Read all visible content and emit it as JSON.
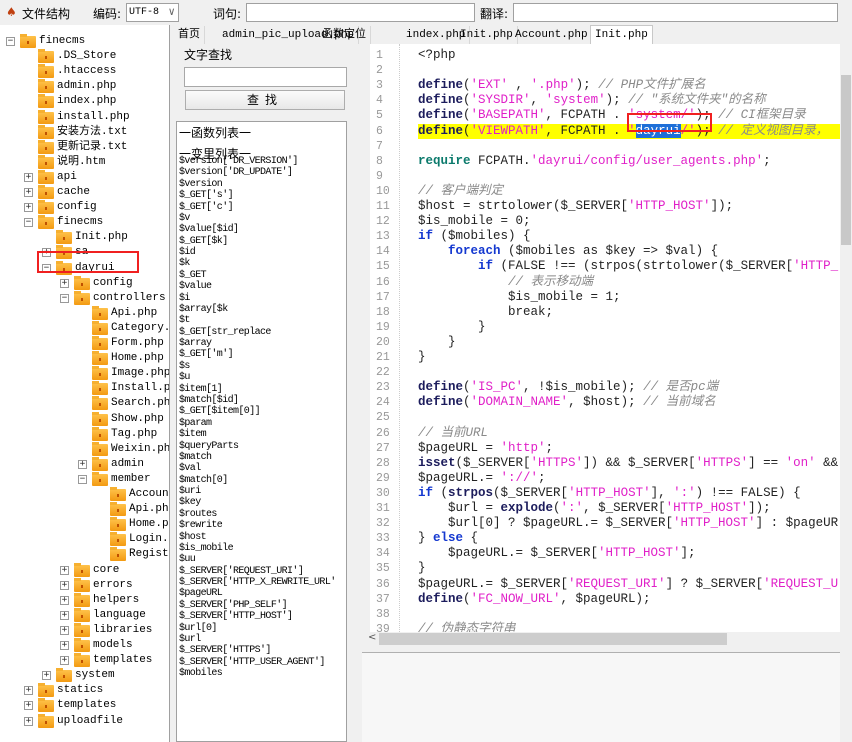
{
  "toolbar": {
    "file_structure_label": "文件结构",
    "encoding_label": "编码:",
    "encoding_value": "UTF-8",
    "query_label": "词句:",
    "query_value": "",
    "translate_label": "翻译:",
    "translate_value": ""
  },
  "tree": [
    {
      "name": "finecms",
      "level": 0,
      "toggle": "-"
    },
    {
      "name": ".DS_Store",
      "level": 1,
      "toggle": ""
    },
    {
      "name": ".htaccess",
      "level": 1,
      "toggle": ""
    },
    {
      "name": "admin.php",
      "level": 1,
      "toggle": ""
    },
    {
      "name": "index.php",
      "level": 1,
      "toggle": ""
    },
    {
      "name": "install.php",
      "level": 1,
      "toggle": ""
    },
    {
      "name": "安装方法.txt",
      "level": 1,
      "toggle": ""
    },
    {
      "name": "更新记录.txt",
      "level": 1,
      "toggle": ""
    },
    {
      "name": "说明.htm",
      "level": 1,
      "toggle": ""
    },
    {
      "name": "api",
      "level": 1,
      "toggle": "+"
    },
    {
      "name": "cache",
      "level": 1,
      "toggle": "+"
    },
    {
      "name": "config",
      "level": 1,
      "toggle": "+"
    },
    {
      "name": "finecms",
      "level": 1,
      "toggle": "-"
    },
    {
      "name": "Init.php",
      "level": 2,
      "toggle": ""
    },
    {
      "name": "sa",
      "level": 2,
      "toggle": "+"
    },
    {
      "name": "dayrui",
      "level": 2,
      "toggle": "-"
    },
    {
      "name": "config",
      "level": 3,
      "toggle": "+"
    },
    {
      "name": "controllers",
      "level": 3,
      "toggle": "-"
    },
    {
      "name": "Api.php",
      "level": 4,
      "toggle": ""
    },
    {
      "name": "Category.p",
      "level": 4,
      "toggle": ""
    },
    {
      "name": "Form.php",
      "level": 4,
      "toggle": ""
    },
    {
      "name": "Home.php",
      "level": 4,
      "toggle": ""
    },
    {
      "name": "Image.php",
      "level": 4,
      "toggle": ""
    },
    {
      "name": "Install.ph",
      "level": 4,
      "toggle": ""
    },
    {
      "name": "Search.php",
      "level": 4,
      "toggle": ""
    },
    {
      "name": "Show.php",
      "level": 4,
      "toggle": ""
    },
    {
      "name": "Tag.php",
      "level": 4,
      "toggle": ""
    },
    {
      "name": "Weixin.php",
      "level": 4,
      "toggle": ""
    },
    {
      "name": "admin",
      "level": 4,
      "toggle": "+"
    },
    {
      "name": "member",
      "level": 4,
      "toggle": "-"
    },
    {
      "name": "Account",
      "level": 5,
      "toggle": ""
    },
    {
      "name": "Api.php",
      "level": 5,
      "toggle": ""
    },
    {
      "name": "Home.pl",
      "level": 5,
      "toggle": ""
    },
    {
      "name": "Login.p",
      "level": 5,
      "toggle": ""
    },
    {
      "name": "Regist",
      "level": 5,
      "toggle": ""
    },
    {
      "name": "core",
      "level": 3,
      "toggle": "+"
    },
    {
      "name": "errors",
      "level": 3,
      "toggle": "+"
    },
    {
      "name": "helpers",
      "level": 3,
      "toggle": "+"
    },
    {
      "name": "language",
      "level": 3,
      "toggle": "+"
    },
    {
      "name": "libraries",
      "level": 3,
      "toggle": "+"
    },
    {
      "name": "models",
      "level": 3,
      "toggle": "+"
    },
    {
      "name": "templates",
      "level": 3,
      "toggle": "+"
    },
    {
      "name": "system",
      "level": 2,
      "toggle": "+"
    },
    {
      "name": "statics",
      "level": 1,
      "toggle": "+"
    },
    {
      "name": "templates",
      "level": 1,
      "toggle": "+"
    },
    {
      "name": "uploadfile",
      "level": 1,
      "toggle": "+"
    }
  ],
  "tree_highlighted": "dayrui",
  "tabs": [
    {
      "label": "首页",
      "active": false
    },
    {
      "label": "admin_pic_upload.php",
      "active": false
    },
    {
      "label": "函数定位",
      "active": false
    },
    {
      "label": "index.php",
      "active": false
    },
    {
      "label": "Init.php",
      "active": false
    },
    {
      "label": "Account.php",
      "active": false
    },
    {
      "label": "Init.php",
      "active": true
    }
  ],
  "search": {
    "group_label": "文字查找",
    "input_value": "",
    "button_label": "查找"
  },
  "func_list": {
    "functions_header": "一函数列表一",
    "variables_header": "一变里列表一",
    "variables": [
      "$version['DR_VERSION']",
      "$version['DR_UPDATE']",
      "$version",
      "$_GET['s']",
      "$_GET['c']",
      "$v",
      "$value[$id]",
      "$_GET[$k]",
      "$id",
      "$k",
      "$_GET",
      "$value",
      "$i",
      "$array[$k",
      "$t",
      "$_GET[str_replace",
      "$array",
      "$_GET['m']",
      "$s",
      "$u",
      "$item[1]",
      "$match[$id]",
      "$_GET[$item[0]]",
      "$param",
      "$item",
      "$queryParts",
      "$match",
      "$val",
      "$match[0]",
      "$uri",
      "$key",
      "$routes",
      "$rewrite",
      "$host",
      "$is_mobile",
      "$uu",
      "$_SERVER['REQUEST_URI']",
      "$_SERVER['HTTP_X_REWRITE_URL'",
      "$pageURL",
      "$_SERVER['PHP_SELF']",
      "$_SERVER['HTTP_HOST']",
      "$url[0]",
      "$url",
      "$_SERVER['HTTPS']",
      "$_SERVER['HTTP_USER_AGENT']",
      "$mobiles"
    ]
  },
  "editor": {
    "highlight_line": 6,
    "colors": {
      "keyword": "#1c1c5c",
      "string": "#e020c8",
      "comment": "#8a8a8a",
      "control": "#1438d0",
      "highlight": "#ffff00",
      "selection": "#1e6fd8",
      "annotation_box": "#f02020"
    },
    "lines": [
      [
        [
          "",
          "<?php"
        ]
      ],
      [],
      [
        [
          "kw",
          "define"
        ],
        [
          "",
          "("
        ],
        [
          "st",
          "'EXT'"
        ],
        [
          "",
          " , "
        ],
        [
          "st",
          "'.php'"
        ],
        [
          "",
          "); "
        ],
        [
          "cm",
          "// PHP文件扩展名"
        ]
      ],
      [
        [
          "kw",
          "define"
        ],
        [
          "",
          "("
        ],
        [
          "st",
          "'SYSDIR'"
        ],
        [
          "",
          ", "
        ],
        [
          "st",
          "'system'"
        ],
        [
          "",
          "); "
        ],
        [
          "cm",
          "// \"系统文件夹\"的名称"
        ]
      ],
      [
        [
          "kw",
          "define"
        ],
        [
          "",
          "("
        ],
        [
          "st",
          "'BASEPATH'"
        ],
        [
          "",
          ", FCPATH . "
        ],
        [
          "st",
          "'system/'"
        ],
        [
          "",
          "); "
        ],
        [
          "cm",
          "// CI框架目录"
        ]
      ],
      [
        [
          "kw",
          "define"
        ],
        [
          "",
          "("
        ],
        [
          "st",
          "'VIEWPATH'"
        ],
        [
          "",
          ", FCPATH . "
        ],
        [
          "st",
          "'"
        ],
        [
          "sel",
          "dayrui"
        ],
        [
          "st",
          "/'"
        ],
        [
          "",
          "); "
        ],
        [
          "cm",
          "// 定义视图目录，"
        ]
      ],
      [],
      [
        [
          "rq",
          "require"
        ],
        [
          "",
          " FCPATH."
        ],
        [
          "st",
          "'dayrui/config/user_agents.php'"
        ],
        [
          "",
          ";"
        ]
      ],
      [],
      [
        [
          "cm",
          "// 客户端判定"
        ]
      ],
      [
        [
          "",
          "$host = strtolower($_SERVER["
        ],
        [
          "st",
          "'HTTP_HOST'"
        ],
        [
          "",
          "]);"
        ]
      ],
      [
        [
          "",
          "$is_mobile = 0;"
        ]
      ],
      [
        [
          "ct",
          "if"
        ],
        [
          "",
          " ($mobiles) {"
        ]
      ],
      [
        [
          "",
          "    "
        ],
        [
          "ct",
          "foreach"
        ],
        [
          "",
          " ($mobiles as $key => $val) {"
        ]
      ],
      [
        [
          "",
          "        "
        ],
        [
          "ct",
          "if"
        ],
        [
          "",
          " (FALSE !== (strpos(strtolower($_SERVER["
        ],
        [
          "st",
          "'HTTP_"
        ]
      ],
      [
        [
          "",
          "            "
        ],
        [
          "cm",
          "// 表示移动端"
        ]
      ],
      [
        [
          "",
          "            $is_mobile = 1;"
        ]
      ],
      [
        [
          "",
          "            break;"
        ]
      ],
      [
        [
          "",
          "        }"
        ]
      ],
      [
        [
          "",
          "    }"
        ]
      ],
      [
        [
          "",
          "}"
        ]
      ],
      [],
      [
        [
          "kw",
          "define"
        ],
        [
          "",
          "("
        ],
        [
          "st",
          "'IS_PC'"
        ],
        [
          "",
          ", !$is_mobile); "
        ],
        [
          "cm",
          "// 是否pc端"
        ]
      ],
      [
        [
          "kw",
          "define"
        ],
        [
          "",
          "("
        ],
        [
          "st",
          "'DOMAIN_NAME'"
        ],
        [
          "",
          ", $host); "
        ],
        [
          "cm",
          "// 当前域名"
        ]
      ],
      [],
      [
        [
          "cm",
          "// 当前URL"
        ]
      ],
      [
        [
          "",
          "$pageURL = "
        ],
        [
          "st",
          "'http'"
        ],
        [
          "",
          ";"
        ]
      ],
      [
        [
          "kw",
          "isset"
        ],
        [
          "",
          "($_SERVER["
        ],
        [
          "st",
          "'HTTPS'"
        ],
        [
          "",
          "]) && $_SERVER["
        ],
        [
          "st",
          "'HTTPS'"
        ],
        [
          "",
          "] == "
        ],
        [
          "st",
          "'on'"
        ],
        [
          "",
          " &&"
        ]
      ],
      [
        [
          "",
          "$pageURL.= "
        ],
        [
          "st",
          "'://'"
        ],
        [
          "",
          ";"
        ]
      ],
      [
        [
          "ct",
          "if"
        ],
        [
          "",
          " ("
        ],
        [
          "kw",
          "strpos"
        ],
        [
          "",
          "($_SERVER["
        ],
        [
          "st",
          "'HTTP_HOST'"
        ],
        [
          "",
          "], "
        ],
        [
          "st",
          "':'"
        ],
        [
          "",
          ") !== FALSE) {"
        ]
      ],
      [
        [
          "",
          "    $url = "
        ],
        [
          "kw",
          "explode"
        ],
        [
          "",
          "("
        ],
        [
          "st",
          "':'"
        ],
        [
          "",
          ", $_SERVER["
        ],
        [
          "st",
          "'HTTP_HOST'"
        ],
        [
          "",
          "]);"
        ]
      ],
      [
        [
          "",
          "    $url[0] ? $pageURL.= $_SERVER["
        ],
        [
          "st",
          "'HTTP_HOST'"
        ],
        [
          "",
          "] : $pageUR"
        ]
      ],
      [
        [
          "",
          "} "
        ],
        [
          "ct",
          "else"
        ],
        [
          "",
          " {"
        ]
      ],
      [
        [
          "",
          "    $pageURL.= $_SERVER["
        ],
        [
          "st",
          "'HTTP_HOST'"
        ],
        [
          "",
          "];"
        ]
      ],
      [
        [
          "",
          "}"
        ]
      ],
      [
        [
          "",
          "$pageURL.= $_SERVER["
        ],
        [
          "st",
          "'REQUEST_URI'"
        ],
        [
          "",
          "] ? $_SERVER["
        ],
        [
          "st",
          "'REQUEST_U"
        ]
      ],
      [
        [
          "kw",
          "define"
        ],
        [
          "",
          "("
        ],
        [
          "st",
          "'FC_NOW_URL'"
        ],
        [
          "",
          ", $pageURL);"
        ]
      ],
      [],
      [
        [
          "cm",
          "// 伪静态字符串"
        ]
      ]
    ]
  }
}
